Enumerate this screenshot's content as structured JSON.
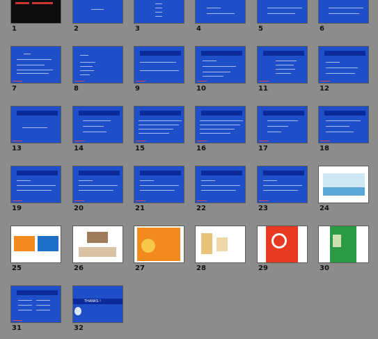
{
  "slides": [
    {
      "number": "1",
      "style": "dark",
      "title": ""
    },
    {
      "number": "2",
      "style": "blue",
      "title": ""
    },
    {
      "number": "3",
      "style": "blue",
      "title": ""
    },
    {
      "number": "4",
      "style": "blue",
      "title": ""
    },
    {
      "number": "5",
      "style": "blue",
      "title": ""
    },
    {
      "number": "6",
      "style": "blue",
      "title": ""
    },
    {
      "number": "7",
      "style": "blue",
      "title": ""
    },
    {
      "number": "8",
      "style": "blue",
      "title": ""
    },
    {
      "number": "9",
      "style": "blue",
      "title": ""
    },
    {
      "number": "10",
      "style": "blue",
      "title": ""
    },
    {
      "number": "11",
      "style": "blue",
      "title": ""
    },
    {
      "number": "12",
      "style": "blue",
      "title": ""
    },
    {
      "number": "13",
      "style": "blue",
      "title": ""
    },
    {
      "number": "14",
      "style": "blue",
      "title": ""
    },
    {
      "number": "15",
      "style": "blue",
      "title": ""
    },
    {
      "number": "16",
      "style": "blue",
      "title": ""
    },
    {
      "number": "17",
      "style": "blue",
      "title": ""
    },
    {
      "number": "18",
      "style": "blue",
      "title": ""
    },
    {
      "number": "19",
      "style": "blue",
      "title": ""
    },
    {
      "number": "20",
      "style": "blue",
      "title": ""
    },
    {
      "number": "21",
      "style": "blue",
      "title": ""
    },
    {
      "number": "22",
      "style": "blue",
      "title": ""
    },
    {
      "number": "23",
      "style": "blue",
      "title": ""
    },
    {
      "number": "24",
      "style": "white",
      "title": ""
    },
    {
      "number": "25",
      "style": "white",
      "title": ""
    },
    {
      "number": "26",
      "style": "white",
      "title": ""
    },
    {
      "number": "27",
      "style": "orange",
      "title": ""
    },
    {
      "number": "28",
      "style": "white",
      "title": ""
    },
    {
      "number": "29",
      "style": "red",
      "title": ""
    },
    {
      "number": "30",
      "style": "green",
      "title": ""
    },
    {
      "number": "31",
      "style": "blue",
      "title": ""
    },
    {
      "number": "32",
      "style": "blue",
      "title": "THANKS !"
    }
  ],
  "colors": {
    "background": "#8c8c8c",
    "slide_blue": "#1f4fc8",
    "title_bar": "#0a2a9a"
  }
}
